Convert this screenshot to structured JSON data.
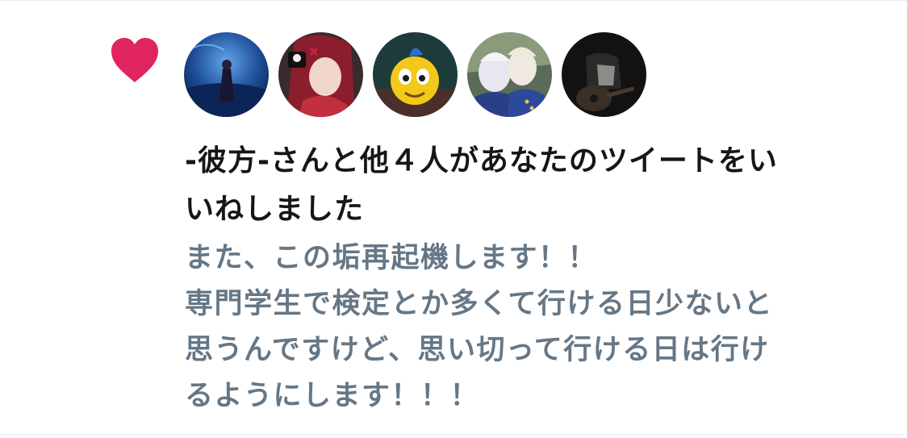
{
  "notification": {
    "type_icon": "heart-icon",
    "accent_color": "#e0245e",
    "liker_name": "-彼方-",
    "headline_rest_line1": "さんと他４人があなたのツイートをい",
    "headline_line2": "いねしました",
    "tweet_lines": [
      "また、この垢再起機します！！",
      "専門学生で検定とか多くて行ける日少ないと",
      "思うんですけど、思い切って行ける日は行け",
      "るようにします！！！"
    ],
    "avatars": [
      {
        "icon": "avatar-1"
      },
      {
        "icon": "avatar-2"
      },
      {
        "icon": "avatar-3"
      },
      {
        "icon": "avatar-4"
      },
      {
        "icon": "avatar-5"
      }
    ]
  }
}
